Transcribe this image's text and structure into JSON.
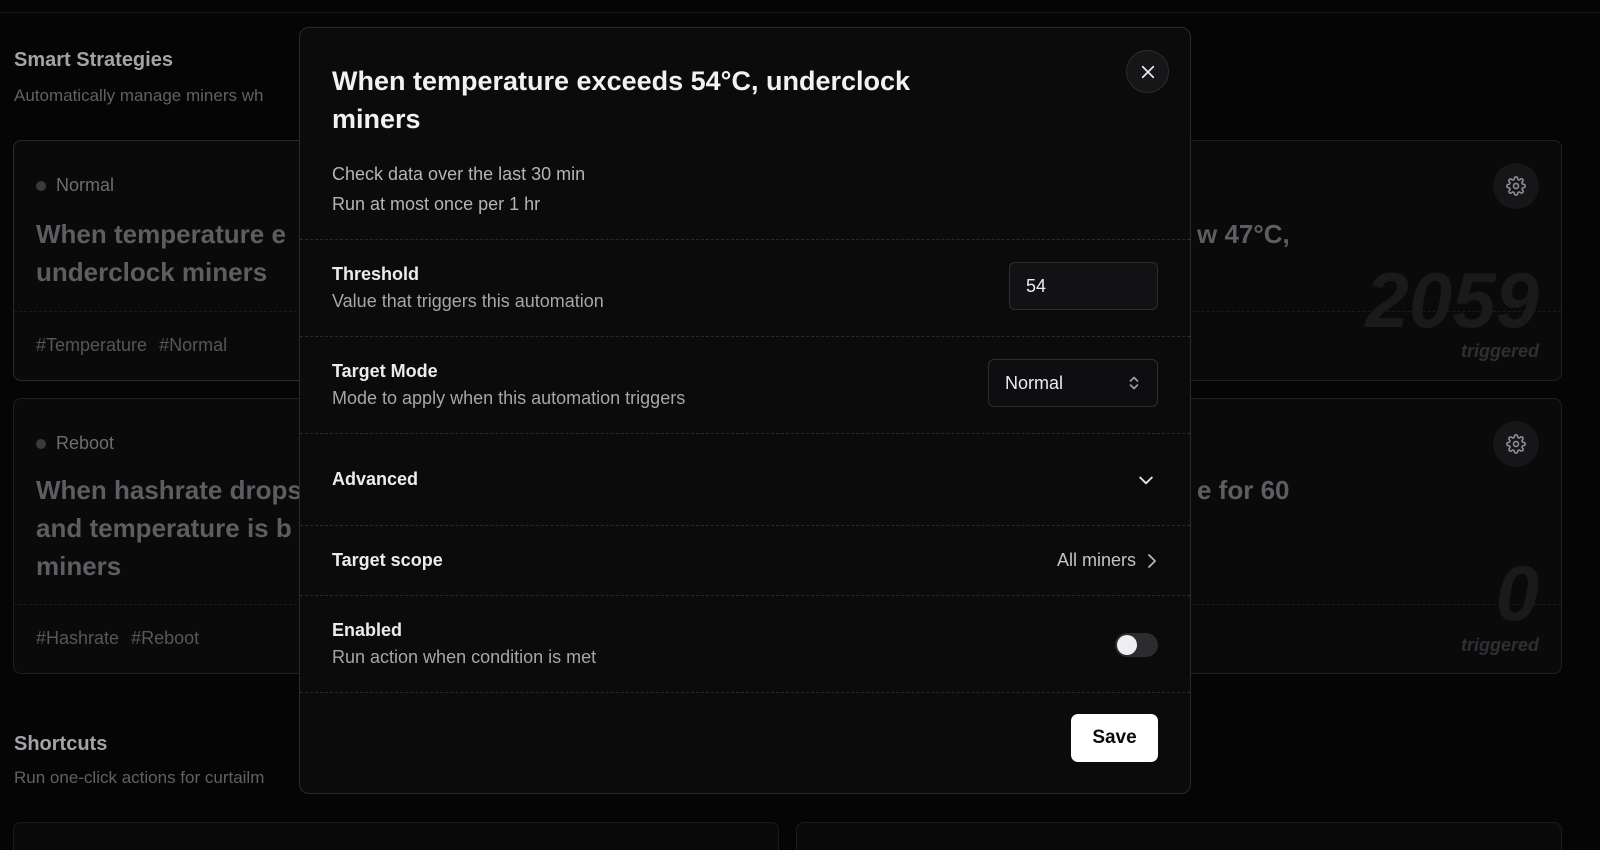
{
  "background": {
    "smart_strategies": {
      "title": "Smart Strategies",
      "subtitle": "Automatically manage miners wh"
    },
    "cards": [
      {
        "mode": "Normal",
        "title": "When temperature e underclock miners",
        "tags": [
          "#Temperature",
          "#Normal"
        ]
      },
      {
        "mode": "Reboot",
        "title": "When hashrate drops and temperature is b miners",
        "tags": [
          "#Hashrate",
          "#Reboot"
        ]
      }
    ],
    "right_cards": [
      {
        "title_fragment": "w 47°C,",
        "count": "2059",
        "count_label": "triggered"
      },
      {
        "title_fragment": "e for 60",
        "count": "0",
        "count_label": "triggered"
      }
    ],
    "shortcuts": {
      "title": "Shortcuts",
      "subtitle": "Run one-click actions for curtailm"
    }
  },
  "modal": {
    "title": "When temperature exceeds 54°C, underclock miners",
    "meta_line1": "Check data over the last 30 min",
    "meta_line2": "Run at most once per 1 hr",
    "threshold": {
      "label": "Threshold",
      "description": "Value that triggers this automation",
      "value": "54"
    },
    "target_mode": {
      "label": "Target Mode",
      "description": "Mode to apply when this automation triggers",
      "selected": "Normal"
    },
    "advanced": {
      "label": "Advanced"
    },
    "target_scope": {
      "label": "Target scope",
      "value": "All miners"
    },
    "enabled": {
      "label": "Enabled",
      "description": "Run action when condition is met",
      "state": false
    },
    "save_label": "Save"
  },
  "icons": {
    "close": "close-icon",
    "gear": "gear-icon",
    "chevron_down": "chevron-down-icon",
    "chevron_right": "chevron-right-icon",
    "select_updown": "chevron-up-down-icon"
  },
  "colors": {
    "background": "#050506",
    "modal_bg": "#0b0b0c",
    "save_bg": "#ffffff"
  }
}
